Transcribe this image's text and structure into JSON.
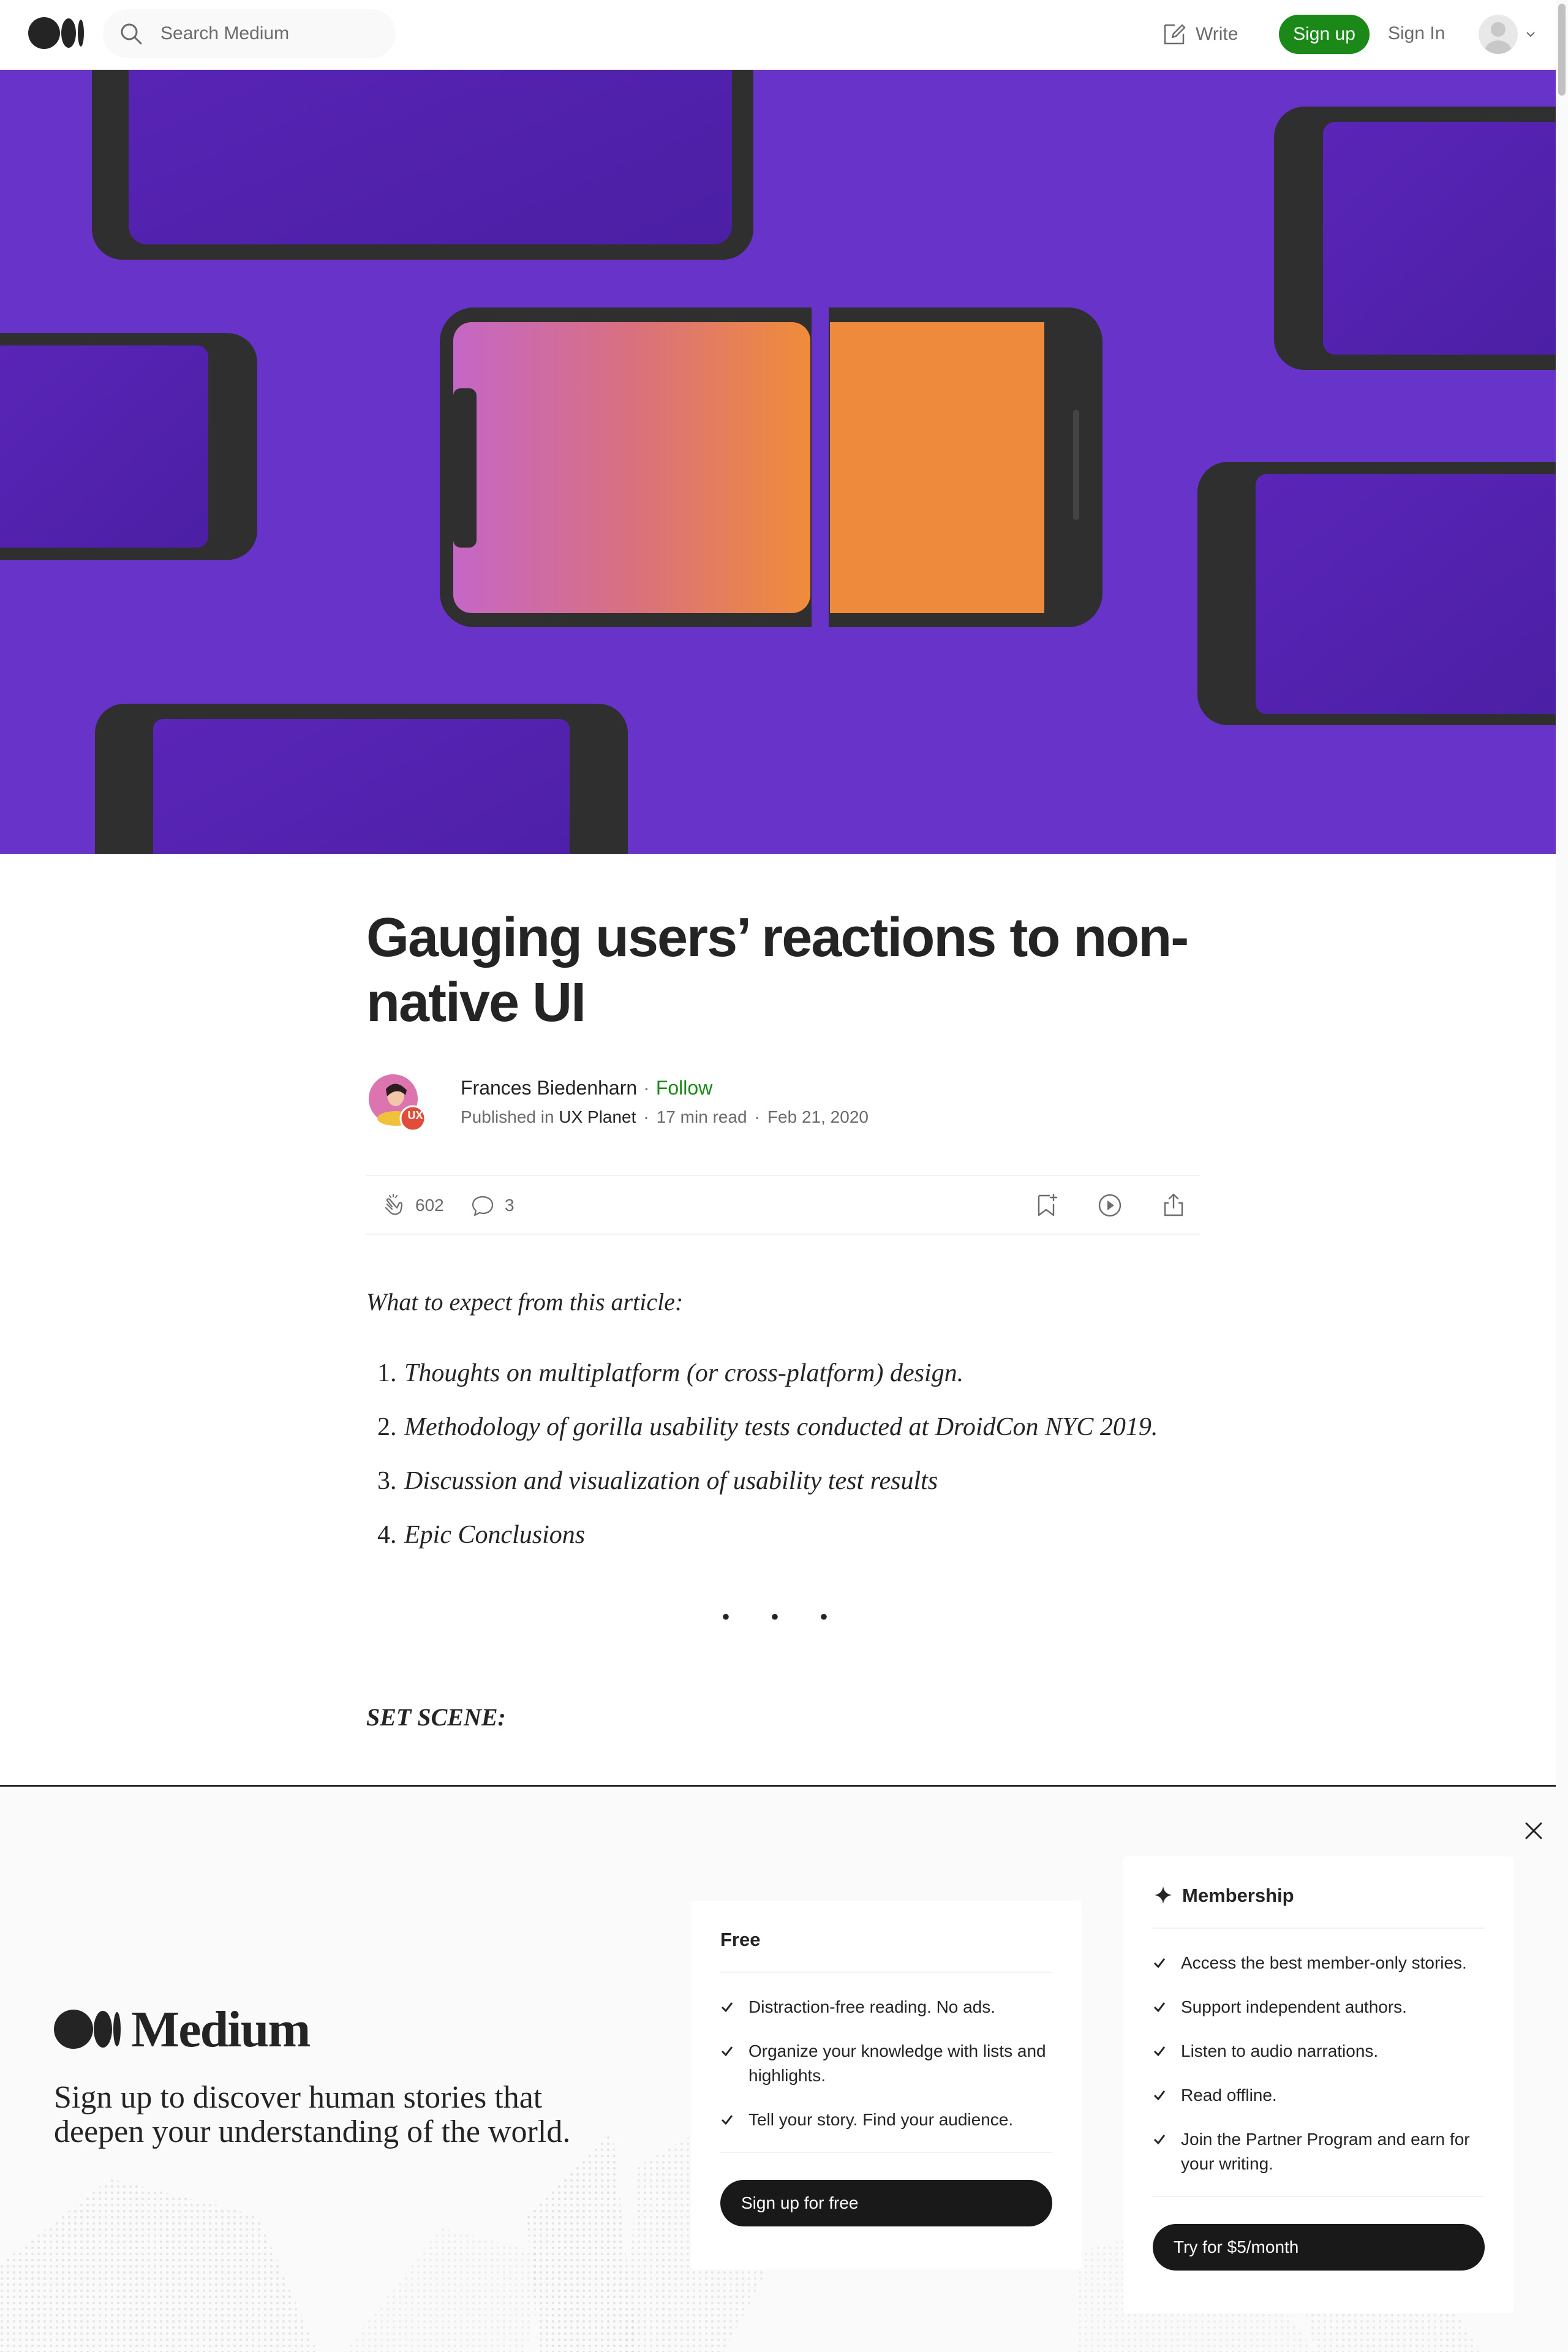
{
  "nav": {
    "search_placeholder": "Search Medium",
    "write_label": "Write",
    "signup_label": "Sign up",
    "signin_label": "Sign In"
  },
  "article": {
    "title": "Gauging users’ reactions to non-native UI",
    "author": "Frances Biedenharn",
    "follow_label": "Follow",
    "published_in_label": "Published in",
    "publication": "UX Planet",
    "avatar_badge": "UX",
    "read_time": "17 min read",
    "date": "Feb 21, 2020",
    "claps": "602",
    "responses": "3",
    "intro": "What to expect from this article:",
    "list": [
      {
        "num": "1.",
        "text": "Thoughts on multiplatform (or cross-platform) design."
      },
      {
        "num": "2.",
        "text": "Methodology of gorilla usability tests conducted at DroidCon NYC 2019."
      },
      {
        "num": "3.",
        "text": "Discussion and visualization of usability test results"
      },
      {
        "num": "4.",
        "text": "Epic Conclusions"
      }
    ],
    "separator": "• • •",
    "section_heading": "SET SCENE:"
  },
  "signup_modal": {
    "brand": "Medium",
    "tagline": "Sign up to discover human stories that deepen your understanding of the world.",
    "free": {
      "title": "Free",
      "features": [
        "Distraction-free reading. No ads.",
        "Organize your knowledge with lists and highlights.",
        "Tell your story. Find your audience."
      ],
      "cta": "Sign up for free"
    },
    "membership": {
      "title": "Membership",
      "features": [
        "Access the best member-only stories.",
        "Support independent authors.",
        "Listen to audio narrations.",
        "Read offline.",
        "Join the Partner Program and earn for your writing."
      ],
      "cta": "Try for $5/month"
    }
  },
  "colors": {
    "brand_green": "#1a8917",
    "hero_purple": "#6833c9",
    "text_dark": "#242424",
    "text_muted": "#6b6b6b"
  },
  "icons": [
    "medium-logo-icon",
    "search-icon",
    "write-icon",
    "chevron-down-icon",
    "clap-icon",
    "comment-icon",
    "bookmark-icon",
    "play-icon",
    "share-icon",
    "close-icon",
    "sparkle-icon",
    "check-icon"
  ]
}
